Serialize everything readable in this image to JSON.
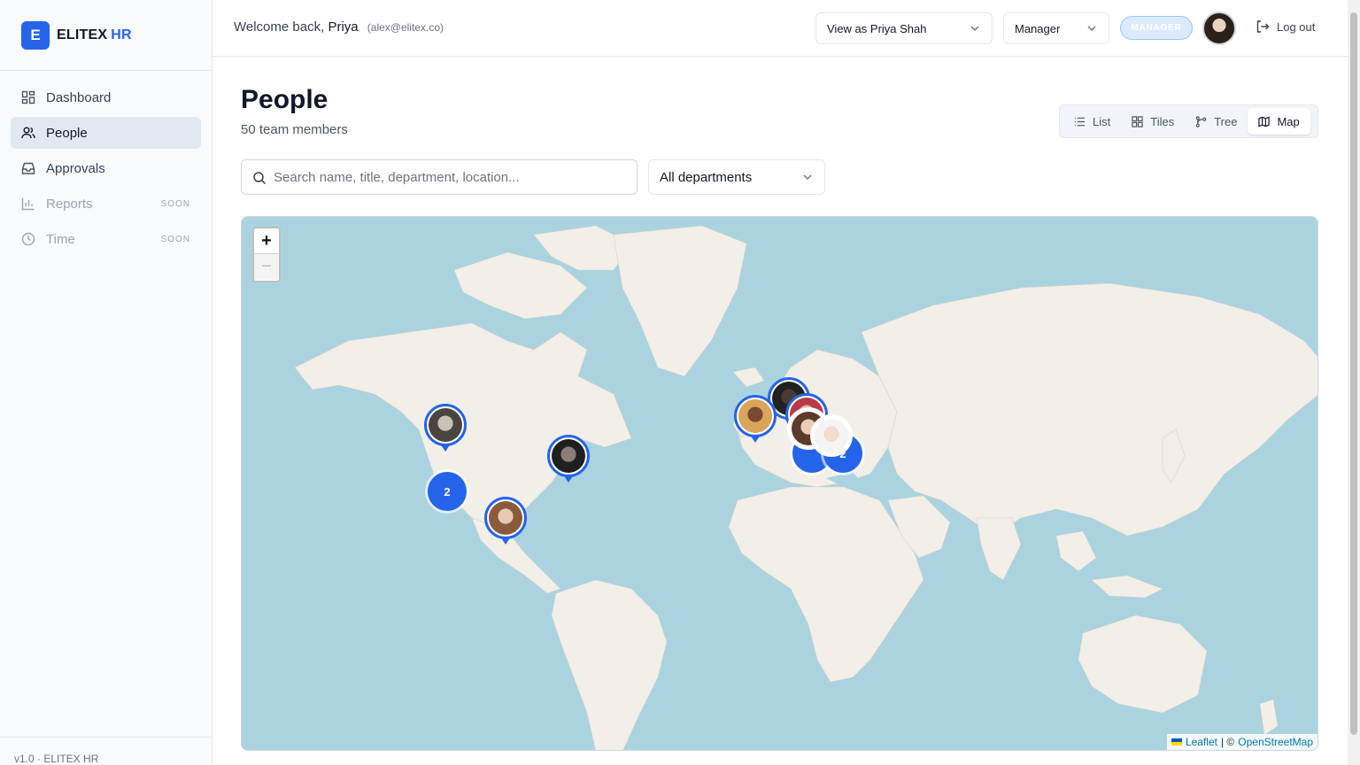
{
  "brand": {
    "logo_letter": "E",
    "name": "ELITEX",
    "name_accent": "HR"
  },
  "sidebar": {
    "items": [
      {
        "label": "Dashboard",
        "icon": "dashboard-icon"
      },
      {
        "label": "People",
        "icon": "people-icon",
        "active": true
      },
      {
        "label": "Approvals",
        "icon": "inbox-icon"
      },
      {
        "label": "Reports",
        "icon": "bar-chart-icon",
        "badge": "SOON",
        "disabled": true
      },
      {
        "label": "Time",
        "icon": "clock-icon",
        "badge": "SOON",
        "disabled": true
      }
    ],
    "version": "v1.0 · ELITEX HR"
  },
  "header": {
    "welcome_prefix": "Welcome back,",
    "user_name": "Priya",
    "user_email": "(alex@elitex.co)",
    "view_as": "View as Priya Shah",
    "role_select": "Manager",
    "role_badge": "MANAGER",
    "logout_label": "Log out"
  },
  "page": {
    "title": "People",
    "subtitle": "50 team members",
    "views": [
      {
        "label": "List",
        "icon": "list-icon"
      },
      {
        "label": "Tiles",
        "icon": "grid-icon"
      },
      {
        "label": "Tree",
        "icon": "tree-icon"
      },
      {
        "label": "Map",
        "icon": "map-icon",
        "active": true
      }
    ],
    "search_placeholder": "Search name, title, department, location...",
    "department_filter": "All departments"
  },
  "map": {
    "zoom_in": "+",
    "zoom_out": "−",
    "attribution_leaflet": "Leaflet",
    "attribution_sep": "| ©",
    "attribution_osm": "OpenStreetMap",
    "clusters": [
      "2",
      "2"
    ],
    "colors": {
      "water": "#aad3df",
      "land": "#f2efe9",
      "marker": "#2563eb"
    }
  }
}
